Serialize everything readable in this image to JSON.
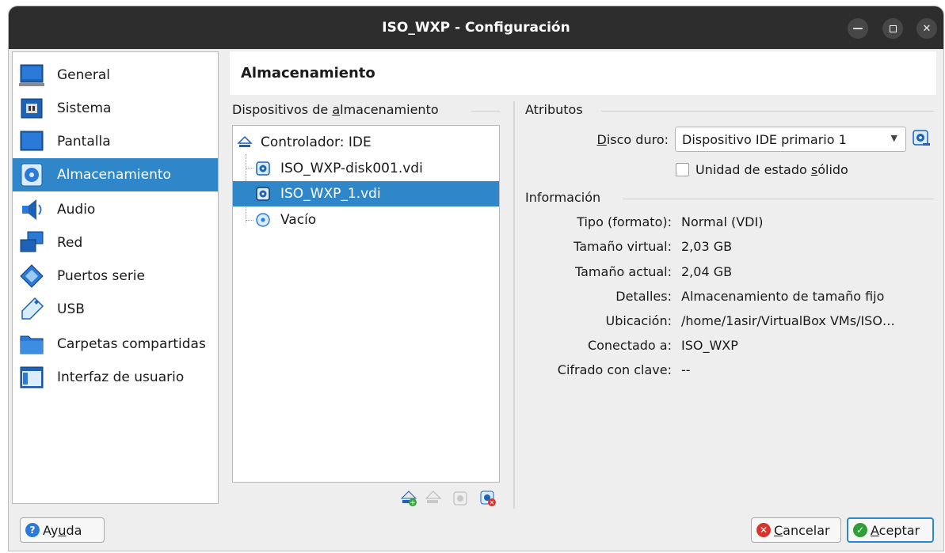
{
  "window": {
    "title": "ISO_WXP - Configuración"
  },
  "sidebar": {
    "items": [
      {
        "label": "General",
        "icon": "general-icon"
      },
      {
        "label": "Sistema",
        "icon": "system-icon"
      },
      {
        "label": "Pantalla",
        "icon": "display-icon"
      },
      {
        "label": "Almacenamiento",
        "icon": "storage-icon",
        "active": true
      },
      {
        "label": "Audio",
        "icon": "audio-icon"
      },
      {
        "label": "Red",
        "icon": "network-icon"
      },
      {
        "label": "Puertos serie",
        "icon": "serial-ports-icon"
      },
      {
        "label": "USB",
        "icon": "usb-icon"
      },
      {
        "label": "Carpetas compartidas",
        "icon": "shared-folders-icon"
      },
      {
        "label": "Interfaz de usuario",
        "icon": "user-interface-icon"
      }
    ]
  },
  "page": {
    "title": "Almacenamiento"
  },
  "storage": {
    "group_label_pre": "Dispositivos de ",
    "group_label_accel": "a",
    "group_label_post": "lmacenamiento",
    "controller": "Controlador: IDE",
    "devices": [
      {
        "label": "ISO_WXP-disk001.vdi",
        "type": "hard-disk"
      },
      {
        "label": "ISO_WXP_1.vdi",
        "type": "hard-disk",
        "selected": true
      },
      {
        "label": "Vacío",
        "type": "optical"
      }
    ]
  },
  "attributes": {
    "group_label": "Atributos",
    "hard_disk_label_accel": "D",
    "hard_disk_label_post": "isco duro:",
    "hard_disk_value": "Dispositivo IDE primario 1",
    "ssd_label_pre": "Unidad de estado ",
    "ssd_label_accel": "s",
    "ssd_label_post": "ólido",
    "ssd_checked": false
  },
  "information": {
    "group_label": "Información",
    "rows": [
      {
        "label": "Tipo (formato):",
        "value": "Normal (VDI)"
      },
      {
        "label": "Tamaño virtual:",
        "value": "2,03 GB"
      },
      {
        "label": "Tamaño actual:",
        "value": "2,04 GB"
      },
      {
        "label": "Detalles:",
        "value": "Almacenamiento de tamaño fijo"
      },
      {
        "label": "Ubicación:",
        "value": "/home/1asir/VirtualBox VMs/ISO…"
      },
      {
        "label": "Conectado a:",
        "value": "ISO_WXP"
      },
      {
        "label": "Cifrado con clave:",
        "value": "--"
      }
    ]
  },
  "buttons": {
    "help_pre": "Ay",
    "help_accel": "u",
    "help_post": "da",
    "cancel_accel": "C",
    "cancel_post": "ancelar",
    "ok_accel": "A",
    "ok_post": "ceptar"
  },
  "colors": {
    "selection": "#2f86c8",
    "titlebar": "#2d2d2d"
  }
}
